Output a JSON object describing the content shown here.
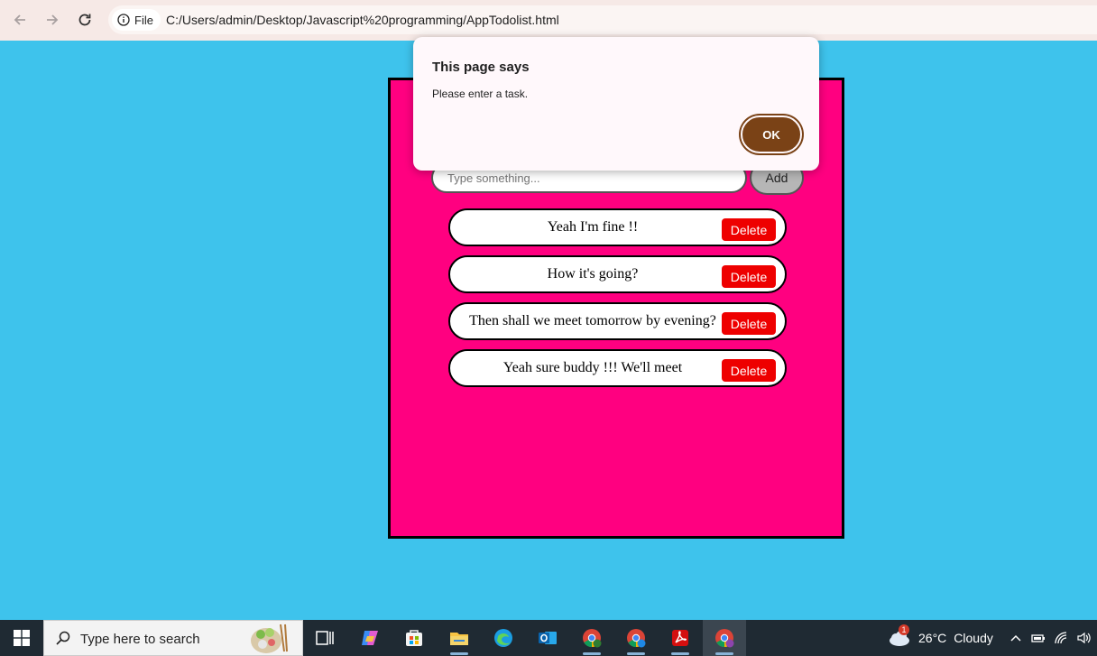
{
  "browser": {
    "site_chip_label": "File",
    "url": "C:/Users/admin/Desktop/Javascript%20programming/AppTodolist.html"
  },
  "app": {
    "input_placeholder": "Type something...",
    "add_label": "Add",
    "tasks": [
      {
        "text": "Yeah I'm fine !!",
        "delete_label": "Delete"
      },
      {
        "text": "How it's going?",
        "delete_label": "Delete"
      },
      {
        "text": "Then shall we meet tomorrow by evening?",
        "delete_label": "Delete"
      },
      {
        "text": "Yeah sure buddy !!! We'll meet",
        "delete_label": "Delete"
      }
    ]
  },
  "dialog": {
    "title": "This page says",
    "message": "Please enter a task.",
    "ok_label": "OK"
  },
  "taskbar": {
    "search_placeholder": "Type here to search",
    "weather_temp": "26°C",
    "weather_condition": "Cloudy",
    "weather_badge": "1",
    "icons": [
      "windows-start-icon",
      "task-view-icon",
      "copilot-icon",
      "microsoft-store-icon",
      "file-explorer-icon",
      "edge-icon",
      "outlook-icon",
      "chrome-icon",
      "chrome-icon",
      "acrobat-icon",
      "chrome-icon"
    ]
  },
  "colors": {
    "page_bg": "#3ec3ec",
    "app_bg": "#ff0080",
    "delete_btn": "#ee0000",
    "ok_btn": "#7a4216"
  }
}
